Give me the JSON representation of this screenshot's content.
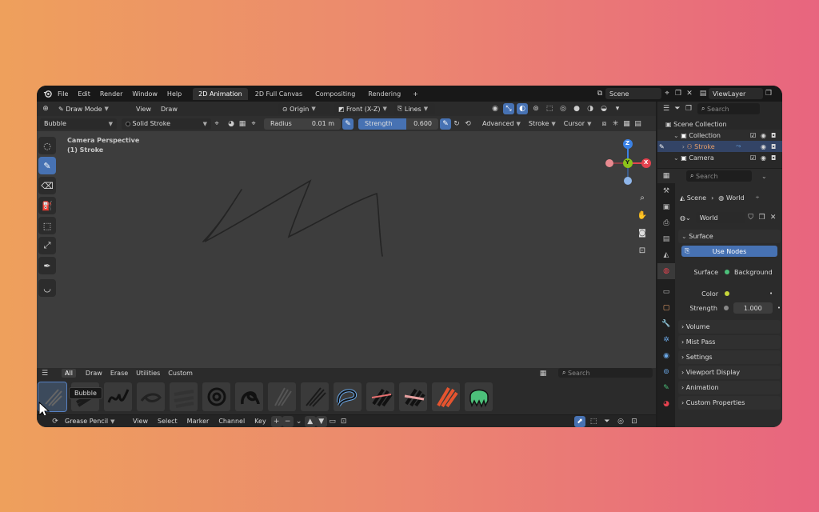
{
  "topbar": {
    "menus": [
      "File",
      "Edit",
      "Render",
      "Window",
      "Help"
    ],
    "workspace_tabs": [
      "2D Animation",
      "2D Full Canvas",
      "Compositing",
      "Rendering"
    ],
    "active_tab": "2D Animation",
    "add_tab": "+",
    "scene": "Scene",
    "view_layer": "ViewLayer"
  },
  "header": {
    "mode": "Draw Mode",
    "view": "View",
    "draw": "Draw",
    "origin": "Origin",
    "front": "Front (X-Z)",
    "lines": "Lines"
  },
  "tool_settings": {
    "brush": "Bubble",
    "material": "Solid Stroke",
    "radius_label": "Radius",
    "radius_value": "0.01 m",
    "strength_label": "Strength",
    "strength_value": "0.600",
    "advanced": "Advanced",
    "stroke": "Stroke",
    "cursor": "Cursor"
  },
  "viewport": {
    "camera_label": "Camera Perspective",
    "object_label": "(1) Stroke",
    "axis_z": "Z",
    "axis_x": "X",
    "axis_y": "Y"
  },
  "asset_shelf": {
    "tabs": [
      "All",
      "Draw",
      "Erase",
      "Utilities",
      "Custom"
    ],
    "active_tab": "All",
    "search_placeholder": "Search",
    "tooltip": "Bubble"
  },
  "bottombar": {
    "editor": "Grease Pencil",
    "items": [
      "View",
      "Select",
      "Marker",
      "Channel",
      "Key"
    ]
  },
  "outliner": {
    "search_placeholder": "Search",
    "root": "Scene Collection",
    "items": [
      "Collection",
      "Stroke",
      "Camera"
    ]
  },
  "properties": {
    "search_placeholder": "Search",
    "breadcrumb_scene": "Scene",
    "breadcrumb_world": "World",
    "world_name": "World",
    "surface_panel": "Surface",
    "use_nodes": "Use Nodes",
    "surface_label": "Surface",
    "surface_value": "Background",
    "color_label": "Color",
    "strength_label": "Strength",
    "strength_value": "1.000",
    "panels": [
      "Volume",
      "Mist Pass",
      "Settings",
      "Viewport Display",
      "Animation",
      "Custom Properties"
    ]
  },
  "colors": {
    "accent": "#4772b3",
    "axis_x": "#e5424f",
    "axis_y": "#8cc21a",
    "axis_z": "#3b82e6",
    "background_left": "#eea05c",
    "background_right": "#e8657f",
    "color_swatch": "#c6d63a"
  }
}
